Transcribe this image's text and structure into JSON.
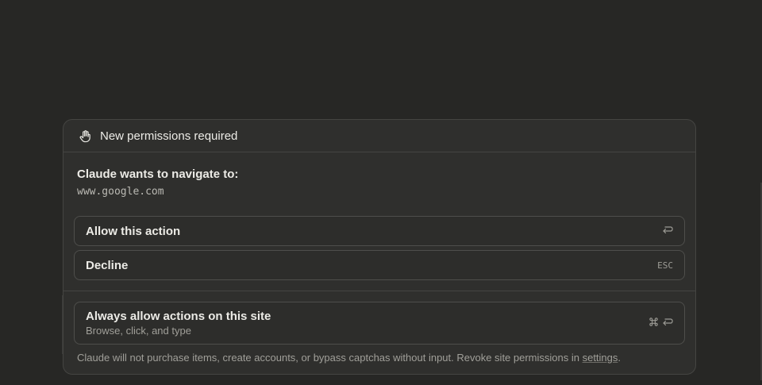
{
  "dialog": {
    "title": "New permissions required",
    "request_label": "Claude wants to navigate to:",
    "request_url": "www.google.com"
  },
  "options": {
    "allow": {
      "label": "Allow this action",
      "shortcut_icon": "return-icon"
    },
    "decline": {
      "label": "Decline",
      "shortcut": "ESC"
    },
    "always": {
      "label": "Always allow actions on this site",
      "sublabel": "Browse, click, and type",
      "shortcut_icons": [
        "command-icon",
        "return-icon"
      ]
    }
  },
  "footer": {
    "note": "Claude will not purchase items, create accounts, or bypass captchas without input. Revoke site permissions in ",
    "link": "settings",
    "end": "."
  },
  "colors": {
    "background": "#272725",
    "dialog": "#2f2f2d",
    "border": "#454542",
    "text": "#ecebe6",
    "muted": "#a09f99"
  }
}
